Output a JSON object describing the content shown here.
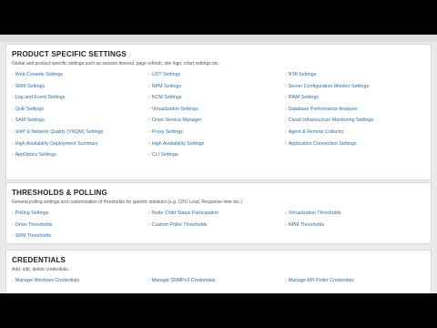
{
  "product": {
    "title": "PRODUCT SPECIFIC SETTINGS",
    "description": "Global and product-specific settings such as session timeout, page refresh, site logo, chart settings etc.",
    "columns": [
      [
        "Web Console Settings",
        "SRM Settings",
        "Log and Event Settings",
        "QoE Settings",
        "SAM Settings",
        "VoIP & Network Quality (VNQM) Settings",
        "High Availability Deployment Summary",
        "AppOptics Settings"
      ],
      [
        "UDT Settings",
        "NPM Settings",
        "NCM Settings",
        "Virtualization Settings",
        "Orion Service Manager",
        "Proxy Settings",
        "High Availability Settings",
        "CLI Settings"
      ],
      [
        "NTA Settings",
        "Server Configuration Monitor Settings",
        "IPAM Settings",
        "Database Performance Analyzer",
        "Cloud Infrastructure Monitoring Settings",
        "Agent & Remote Collector",
        "Application Connection Settings"
      ]
    ]
  },
  "thresholds": {
    "title": "THRESHOLDS & POLLING",
    "description": "General polling settings and customization of thresholds for specific statistics (e.g. CPU Load, Response time etc.)",
    "columns": [
      [
        "Polling Settings",
        "Orion Thresholds",
        "SRM Thresholds"
      ],
      [
        "Node Child Status Participation",
        "Custom Poller Thresholds"
      ],
      [
        "Virtualization Thresholds",
        "NPM Thresholds"
      ]
    ]
  },
  "credentials": {
    "title": "CREDENTIALS",
    "description": "Add, edit, delete credentials.",
    "columns": [
      [
        "Manage Windows Credentials"
      ],
      [
        "Manage SNMPv3 Credentials"
      ],
      [
        "Manage API Poller Credentials"
      ]
    ]
  }
}
